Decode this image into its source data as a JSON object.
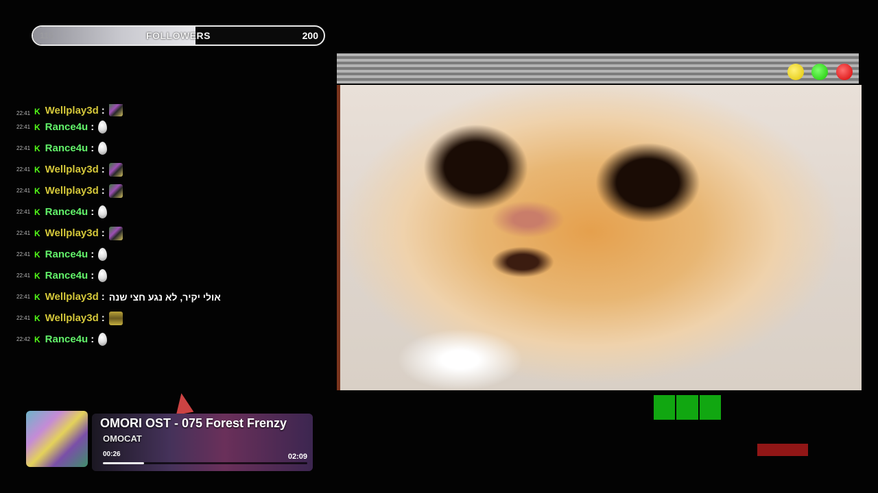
{
  "followers": {
    "label": "FOLLOWERS",
    "current": 115,
    "goal": 200,
    "progress": 0.56
  },
  "chat": [
    {
      "time": "22:41",
      "user": "Wellplay3d",
      "color": "#d4c73a",
      "message": "",
      "emote": "glitch"
    },
    {
      "time": "22:41",
      "user": "Rance4u",
      "color": "#62f26a",
      "message": "",
      "emote": "drop"
    },
    {
      "time": "22:41",
      "user": "Rance4u",
      "color": "#62f26a",
      "message": "",
      "emote": "drop"
    },
    {
      "time": "22:41",
      "user": "Wellplay3d",
      "color": "#d4c73a",
      "message": "",
      "emote": "glitch"
    },
    {
      "time": "22:41",
      "user": "Wellplay3d",
      "color": "#d4c73a",
      "message": "",
      "emote": "glitch"
    },
    {
      "time": "22:41",
      "user": "Rance4u",
      "color": "#62f26a",
      "message": "",
      "emote": "drop"
    },
    {
      "time": "22:41",
      "user": "Wellplay3d",
      "color": "#d4c73a",
      "message": "",
      "emote": "glitch"
    },
    {
      "time": "22:41",
      "user": "Rance4u",
      "color": "#62f26a",
      "message": "",
      "emote": "drop"
    },
    {
      "time": "22:41",
      "user": "Rance4u",
      "color": "#62f26a",
      "message": "",
      "emote": "drop"
    },
    {
      "time": "22:41",
      "user": "Wellplay3d",
      "color": "#d4c73a",
      "message": "אולי יקיר, לא נגע חצי שנה",
      "emote": ""
    },
    {
      "time": "22:41",
      "user": "Wellplay3d",
      "color": "#d4c73a",
      "message": "",
      "emote": "box"
    },
    {
      "time": "22:42",
      "user": "Rance4u",
      "color": "#62f26a",
      "message": "",
      "emote": "drop"
    }
  ],
  "video_window": {
    "buttons": [
      "minimize-icon",
      "maximize-icon",
      "close-icon"
    ]
  },
  "music": {
    "title": "OMORI OST - 075 Forest Frenzy",
    "artist": "OMOCAT",
    "elapsed": "00:26",
    "total": "02:09",
    "progress": 0.2
  }
}
